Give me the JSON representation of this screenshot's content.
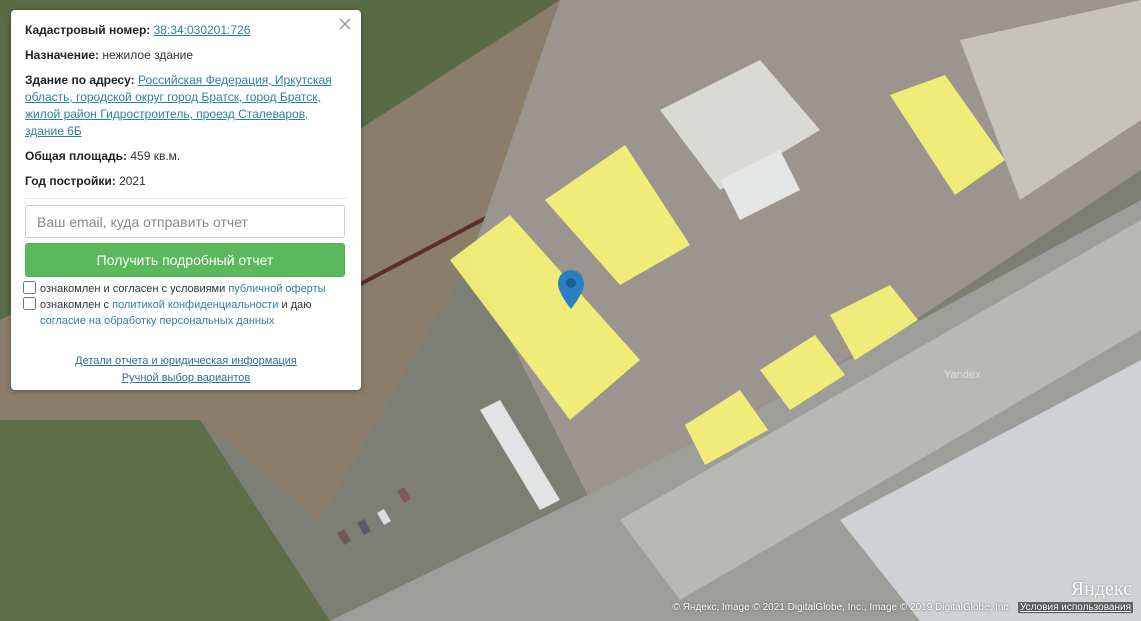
{
  "info": {
    "cadastral_label": "Кадастровый номер:",
    "cadastral_value": "38:34:030201:726",
    "purpose_label": "Назначение:",
    "purpose_value": "нежилое здание",
    "address_label": "Здание по адресу:",
    "address_value": "Российская Федерация, Иркутская область, городской округ город Братск, город Братск, жилой район Гидростроитель, проезд Сталеваров, здание 6Б",
    "area_label": "Общая площадь:",
    "area_value": "459 кв.м.",
    "year_label": "Год постройки:",
    "year_value": "2021"
  },
  "form": {
    "email_placeholder": "Ваш email, куда отправить отчет",
    "submit_label": "Получить подробный отчет",
    "offer_text": "ознакомлен и согласен с условиями",
    "offer_link": "публичной оферты",
    "privacy_text": "ознакомлен с",
    "privacy_link": "политикой конфиденциальности",
    "privacy_and": "и даю",
    "consent_link": "согласие на обработку персональных данных"
  },
  "links": {
    "details": "Детали отчета и юридическая информация",
    "manual": "Ручной выбор вариантов"
  },
  "map": {
    "copyright": "© Яндекс, Image © 2021 DigitalGlobe, Inc., Image © 2019 DigitalGlobe, Inc.",
    "terms": "Условия использования",
    "logo": "Яндекс",
    "watermark": "Yandex",
    "marker_color": "#2a7fc0",
    "highlight_color": "#f3f078"
  },
  "icons": {
    "close": "close-icon",
    "marker": "map-pin-icon"
  }
}
